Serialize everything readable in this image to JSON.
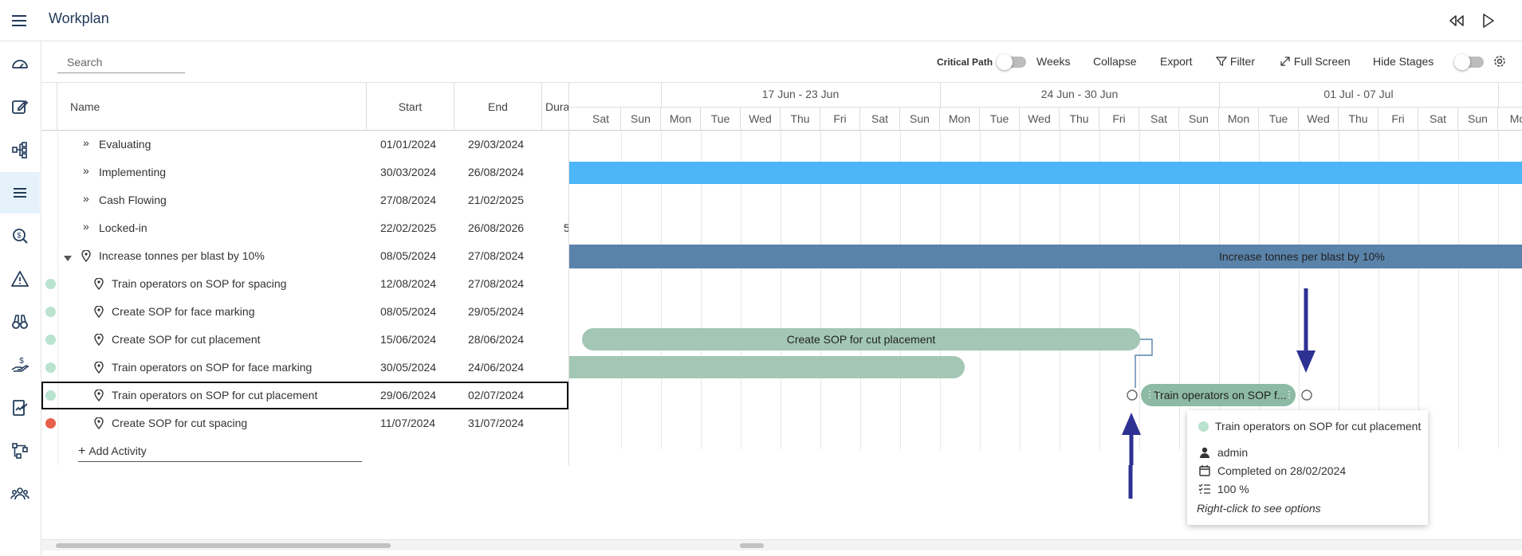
{
  "app": {
    "title": "Workplan"
  },
  "toolbar": {
    "search_placeholder": "Search",
    "critical_path_label": "Critical Path",
    "weeks_label": "Weeks",
    "collapse_label": "Collapse",
    "export_label": "Export",
    "filter_label": "Filter",
    "fullscreen_label": "Full Screen",
    "hide_stages_label": "Hide Stages"
  },
  "grid": {
    "columns": {
      "name": "Name",
      "start": "Start",
      "end": "End",
      "duration": "Dura"
    },
    "rows": [
      {
        "name": "Evaluating",
        "start": "01/01/2024",
        "end": "29/03/2024",
        "type": "stage"
      },
      {
        "name": "Implementing",
        "start": "30/03/2024",
        "end": "26/08/2024",
        "type": "stage"
      },
      {
        "name": "Cash Flowing",
        "start": "27/08/2024",
        "end": "21/02/2025",
        "type": "stage"
      },
      {
        "name": "Locked-in",
        "start": "22/02/2025",
        "end": "26/08/2026",
        "type": "stage",
        "dura": "5"
      },
      {
        "name": "Increase tonnes per blast by 10%",
        "start": "08/05/2024",
        "end": "27/08/2024",
        "type": "group"
      },
      {
        "name": "Train operators on SOP for spacing",
        "start": "12/08/2024",
        "end": "27/08/2024",
        "type": "activity",
        "status_color": "#b9e2cf"
      },
      {
        "name": "Create SOP for face marking",
        "start": "08/05/2024",
        "end": "29/05/2024",
        "type": "activity",
        "status_color": "#b9e2cf"
      },
      {
        "name": "Create SOP for cut placement",
        "start": "15/06/2024",
        "end": "28/06/2024",
        "type": "activity",
        "status_color": "#b9e2cf"
      },
      {
        "name": "Train operators on SOP for face marking",
        "start": "30/05/2024",
        "end": "24/06/2024",
        "type": "activity",
        "status_color": "#b9e2cf"
      },
      {
        "name": "Train operators on SOP for cut placement",
        "start": "29/06/2024",
        "end": "02/07/2024",
        "type": "activity",
        "status_color": "#b9e2cf",
        "selected": true
      },
      {
        "name": "Create SOP for cut spacing",
        "start": "11/07/2024",
        "end": "31/07/2024",
        "type": "activity",
        "status_color": "#e8604c"
      }
    ],
    "add_activity_label": "Add Activity"
  },
  "gantt": {
    "weeks": [
      "17 Jun - 23 Jun",
      "24 Jun - 30 Jun",
      "01 Jul - 07 Jul"
    ],
    "days": [
      "Sat",
      "Sun",
      "Mon",
      "Tue",
      "Wed",
      "Thu",
      "Fri",
      "Sat",
      "Sun",
      "Mon",
      "Tue",
      "Wed",
      "Thu",
      "Fri",
      "Sat",
      "Sun",
      "Mon",
      "Tue",
      "Wed",
      "Thu",
      "Fri",
      "Sat",
      "Sun",
      "Mo"
    ],
    "bars": {
      "group_label": "Increase tonnes per blast by 10%",
      "cut_placement_label": "Create SOP for cut placement",
      "train_cut_label": "Train operators on SOP f..."
    },
    "colors": {
      "stage_bar": "#4db6f8",
      "group_bar": "#5a83aa",
      "activity_bar": "#a3c7b5",
      "arrow": "#2e3192"
    }
  },
  "tooltip": {
    "title": "Train operators on SOP for cut placement",
    "user": "admin",
    "completed": "Completed on 28/02/2024",
    "progress": "100 %",
    "hint": "Right-click to see options"
  }
}
